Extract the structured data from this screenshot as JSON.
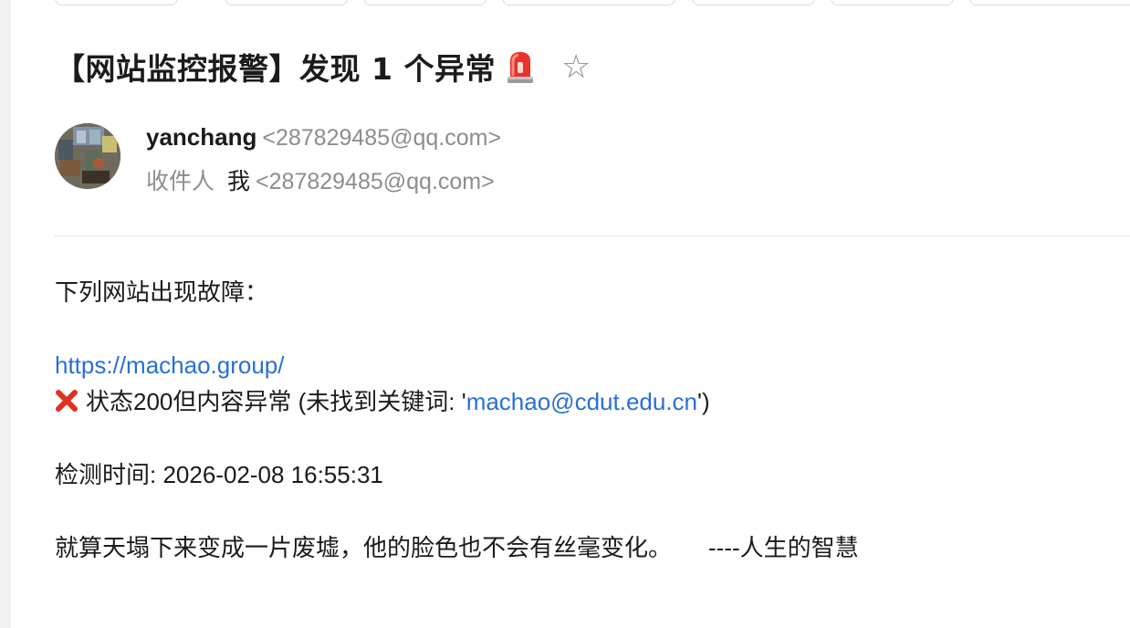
{
  "subject": {
    "title": "【网站监控报警】发现 1 个异常",
    "siren_icon": "police-siren-icon",
    "star_icon": "star-icon",
    "star_glyph": "☆"
  },
  "sender": {
    "name": "yanchang",
    "email": "<287829485@qq.com>"
  },
  "recipient": {
    "label": "收件人",
    "name": "我",
    "email": "<287829485@qq.com>"
  },
  "body": {
    "intro": "下列网站出现故障：",
    "site_url": "https://machao.group/",
    "status_prefix": "状态200但内容异常 (未找到关键词: '",
    "keyword_link": "machao@cdut.edu.cn",
    "status_suffix": "')",
    "check_time": "检测时间: 2026-02-08 16:55:31",
    "quote": "就算天塌下来变成一片废墟，他的脸色也不会有丝毫变化。",
    "quote_source": "----人生的智慧"
  },
  "colors": {
    "link": "#2a6fd6",
    "muted": "#8d8d8d",
    "error_red": "#e0301e",
    "siren_red": "#e8322a"
  }
}
